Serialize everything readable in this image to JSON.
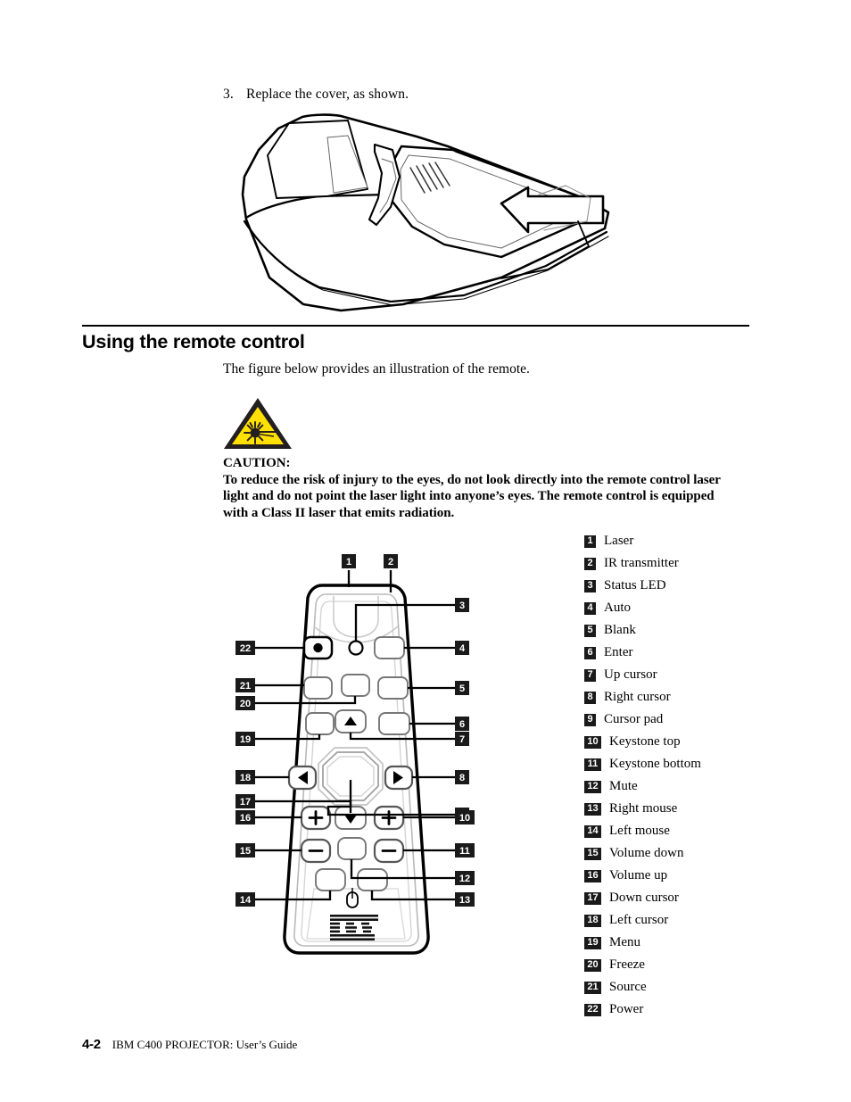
{
  "step": {
    "number": "3.",
    "text": "Replace the cover, as shown."
  },
  "section": {
    "heading": "Using the remote control",
    "intro": "The figure below provides an illustration of the remote."
  },
  "caution": {
    "icon": "laser-warning-triangle-icon",
    "title": "CAUTION:",
    "body": "To reduce the risk of injury to the eyes, do not look directly into the remote control laser light and do not point the laser light into anyone’s eyes. The remote control is equipped with a Class II laser that emits radiation.",
    "triangle_fill": "#FFE000",
    "triangle_stroke": "#231F20"
  },
  "remote": {
    "brand_logo": "ibm-logo",
    "mouse_icon": "mouse-icon",
    "callouts_top": [
      "1",
      "2"
    ],
    "callouts_right": [
      "3",
      "4",
      "5",
      "6",
      "7",
      "8",
      "9",
      "10",
      "11",
      "12",
      "13"
    ],
    "callouts_left": [
      "22",
      "21",
      "20",
      "19",
      "18",
      "17",
      "16",
      "15",
      "14"
    ]
  },
  "legend": {
    "items": [
      {
        "num": "1",
        "label": "Laser"
      },
      {
        "num": "2",
        "label": "IR transmitter"
      },
      {
        "num": "3",
        "label": "Status LED"
      },
      {
        "num": "4",
        "label": "Auto"
      },
      {
        "num": "5",
        "label": "Blank"
      },
      {
        "num": "6",
        "label": "Enter"
      },
      {
        "num": "7",
        "label": "Up cursor"
      },
      {
        "num": "8",
        "label": "Right cursor"
      },
      {
        "num": "9",
        "label": "Cursor pad"
      },
      {
        "num": "10",
        "label": "Keystone top"
      },
      {
        "num": "11",
        "label": "Keystone bottom"
      },
      {
        "num": "12",
        "label": "Mute"
      },
      {
        "num": "13",
        "label": "Right mouse"
      },
      {
        "num": "14",
        "label": "Left mouse"
      },
      {
        "num": "15",
        "label": "Volume down"
      },
      {
        "num": "16",
        "label": "Volume up"
      },
      {
        "num": "17",
        "label": "Down cursor"
      },
      {
        "num": "18",
        "label": "Left cursor"
      },
      {
        "num": "19",
        "label": "Menu"
      },
      {
        "num": "20",
        "label": "Freeze"
      },
      {
        "num": "21",
        "label": "Source"
      },
      {
        "num": "22",
        "label": "Power"
      }
    ]
  },
  "footer": {
    "page": "4-2",
    "title": "IBM C400 PROJECTOR: User’s Guide"
  }
}
